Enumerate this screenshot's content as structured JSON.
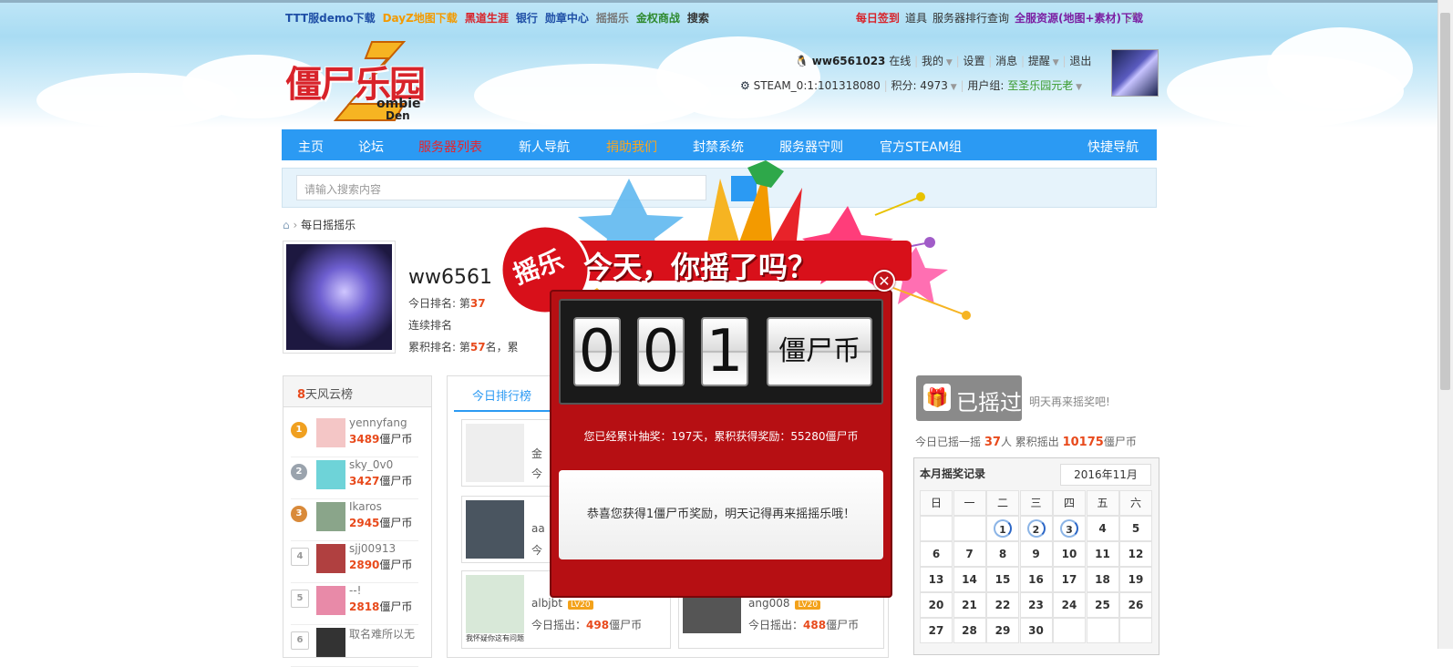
{
  "topbar": {
    "left_links": [
      {
        "label": "TTT服demo下载",
        "color": "#1f4fa6"
      },
      {
        "label": "DayZ地图下载",
        "color": "#f39a00"
      },
      {
        "label": "黑道生涯",
        "color": "#d8232a"
      },
      {
        "label": "银行",
        "color": "#1f4fa6"
      },
      {
        "label": "勋章中心",
        "color": "#1f4fa6"
      },
      {
        "label": "摇摇乐",
        "color": "#777777"
      },
      {
        "label": "金权商战",
        "color": "#2f8a2f"
      },
      {
        "label": "搜索",
        "color": "#333333"
      }
    ],
    "right_links": [
      {
        "label": "每日签到",
        "color": "#d8232a"
      },
      {
        "label": "道具",
        "color": "#333333"
      },
      {
        "label": "服务器排行查询",
        "color": "#333333"
      },
      {
        "label": "全服资源(地图+素材)下载",
        "color": "#7b1fa2"
      }
    ]
  },
  "user": {
    "name": "ww6561023",
    "online": "在线",
    "menu": [
      "我的",
      "设置",
      "消息",
      "提醒",
      "退出"
    ],
    "steam": "STEAM_0:1:101318080",
    "points_label": "积分: 4973",
    "group_label": "用户组:",
    "group_value": "至圣乐园元老"
  },
  "logo": {
    "cn": "僵尸乐园",
    "en1": "ombie",
    "en2": "Den"
  },
  "nav": {
    "items": [
      {
        "label": "主页",
        "color": "#ffffff"
      },
      {
        "label": "论坛",
        "color": "#ffffff"
      },
      {
        "label": "服务器列表",
        "color": "#e8232a"
      },
      {
        "label": "新人导航",
        "color": "#ffffff"
      },
      {
        "label": "捐助我们",
        "color": "#f6a623"
      },
      {
        "label": "封禁系统",
        "color": "#ffffff"
      },
      {
        "label": "服务器守则",
        "color": "#ffffff"
      },
      {
        "label": "官方STEAM组",
        "color": "#ffffff"
      }
    ],
    "quick": "快捷导航"
  },
  "search": {
    "placeholder": "请输入搜索内容"
  },
  "breadcrumb": {
    "current": "每日摇摇乐"
  },
  "profile": {
    "name": "ww6561",
    "rank_today_label": "今日排名: 第",
    "rank_today_value": "37",
    "rank_streak_label": "连续排名",
    "rank_total_label": "累积排名: 第",
    "rank_total_value": "57",
    "rank_total_suffix": "名，累"
  },
  "leftpanel": {
    "title_num": "8",
    "title_text": "天风云榜",
    "unit": "僵尸币",
    "rows": [
      {
        "rank": "1",
        "name": "yennyfang",
        "value": "3489",
        "medal": "#f0a020"
      },
      {
        "rank": "2",
        "name": "sky_0v0",
        "value": "3427",
        "medal": "#9aa3ad"
      },
      {
        "rank": "3",
        "name": "Ikaros",
        "value": "2945",
        "medal": "#d98a3a"
      },
      {
        "rank": "4",
        "name": "sjj00913",
        "value": "2890",
        "medal": "#ffffff"
      },
      {
        "rank": "5",
        "name": "--!",
        "value": "2818",
        "medal": "#ffffff"
      },
      {
        "rank": "6",
        "name": "取名难所以无",
        "value": "",
        "medal": "#ffffff"
      }
    ]
  },
  "tabs": {
    "today": "今日排行榜"
  },
  "cards": [
    {
      "name": "金",
      "value": "",
      "prefix": "今"
    },
    {
      "name": "aa",
      "value": "",
      "prefix": "今"
    },
    {
      "name": "albjbt",
      "value": "498",
      "prefix": "今日摇出："
    },
    {
      "name": "ang008",
      "value": "488",
      "prefix": "今日摇出："
    }
  ],
  "card_unit": "僵尸币",
  "card_level": "LV20",
  "card_caption": "我怀疑你这有问题",
  "shook": {
    "label": "已摇过",
    "tomorrow": "明天再来摇奖吧!"
  },
  "stats": {
    "prefix": "今日已摇一摇",
    "people": "37",
    "people_suffix": "人 累积摇出",
    "total": "10175",
    "unit": "僵尸币"
  },
  "calendar": {
    "title": "本月摇奖记录",
    "month": "2016年11月",
    "weekdays": [
      "日",
      "一",
      "二",
      "三",
      "四",
      "五",
      "六"
    ],
    "weeks": [
      [
        "",
        "",
        "1",
        "2",
        "3",
        "4",
        "5"
      ],
      [
        "6",
        "7",
        "8",
        "9",
        "10",
        "11",
        "12"
      ],
      [
        "13",
        "14",
        "15",
        "16",
        "17",
        "18",
        "19"
      ],
      [
        "20",
        "21",
        "22",
        "23",
        "24",
        "25",
        "26"
      ],
      [
        "27",
        "28",
        "29",
        "30",
        "",
        "",
        ""
      ]
    ],
    "marked": [
      "1",
      "2",
      "3"
    ]
  },
  "modal": {
    "badge": "摇乐",
    "headline": "今天，你摇了吗？",
    "digits": [
      "0",
      "0",
      "1"
    ],
    "unit": "僵尸币",
    "total": "您已经累计抽奖：197天，累积获得奖励：55280僵尸币",
    "message": "恭喜您获得1僵尸币奖励，明天记得再来摇摇乐哦！"
  }
}
